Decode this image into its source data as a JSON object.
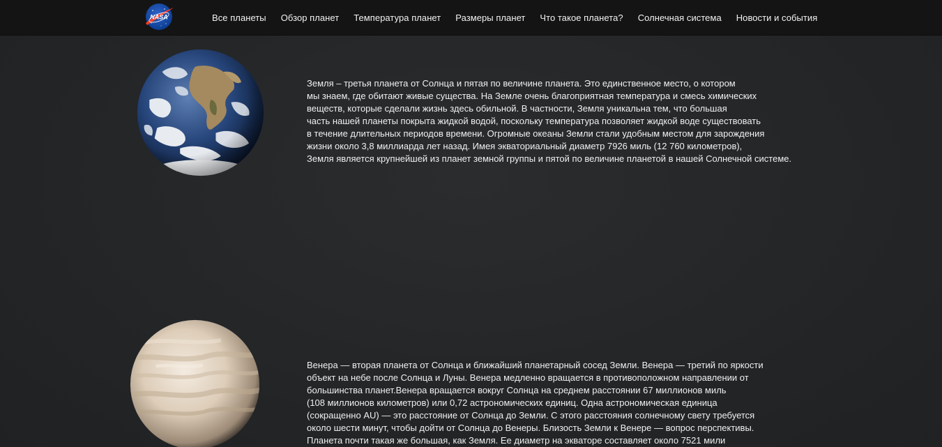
{
  "logo": {
    "text": "NASA",
    "icon": "nasa-meatball-logo"
  },
  "nav": {
    "items": [
      "Все планеты",
      "Обзор планет",
      "Температура планет",
      "Размеры планет",
      "Что такое планета?",
      "Солнечная система",
      "Новости и события"
    ]
  },
  "colors": {
    "navbar": "#141414",
    "background": "#232527",
    "text": "#f0f0f0"
  },
  "planets": [
    {
      "name_icon": "earth-image",
      "lines": [
        "Земля – третья планета от Солнца и пятая по величине планета. Это единственное место, о котором",
        "мы знаем, где обитают живые существа. На Земле очень благоприятная температура и смесь химических",
        "веществ, которые сделали жизнь здесь обильной. В частности, Земля уникальна тем, что большая",
        "часть нашей планеты покрыта жидкой водой, поскольку температура позволяет жидкой воде существовать",
        "в течение длительных периодов времени. Огромные океаны Земли стали удобным местом для зарождения",
        "жизни около 3,8 миллиарда лет назад. Имея экваториальный диаметр 7926 миль (12 760 километров),",
        "Земля является крупнейшей из планет земной группы и пятой по величине планетой в нашей Солнечной системе."
      ]
    },
    {
      "name_icon": "venus-image",
      "lines": [
        "Венера — вторая планета от Солнца и ближайший планетарный сосед Земли. Венера — третий по яркости",
        "объект на небе после Солнца и Луны. Венера медленно вращается в противоположном направлении от",
        "большинства планет.Венера вращается вокруг Солнца на среднем расстоянии 67 миллионов миль",
        "(108 миллионов километров) или 0,72 астрономических единиц. Одна астрономическая единица",
        "(сокращенно AU) — это расстояние от Солнца до Земли. С этого расстояния солнечному свету требуется",
        "около шести минут, чтобы дойти от Солнца до Венеры. Близость Земли к Венере — вопрос перспективы.",
        "Планета почти такая же большая, как Земля. Ее диаметр на экваторе составляет около 7521 мили"
      ]
    }
  ]
}
